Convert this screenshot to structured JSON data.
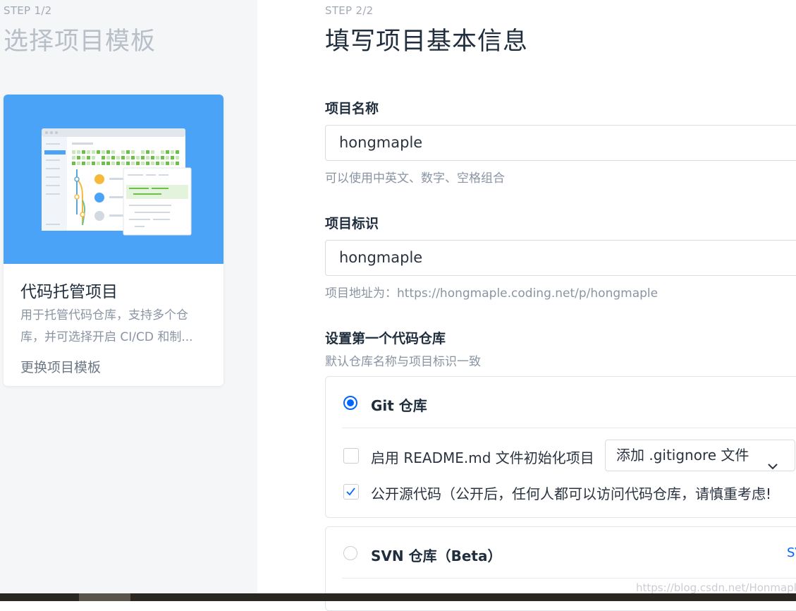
{
  "left_panel": {
    "step": "STEP 1/2",
    "title": "选择项目模板",
    "card": {
      "title": "代码托管项目",
      "description": "用于托管代码仓库，支持多个仓库，并可选择开启 CI/CD 和制...",
      "change_link": "更换项目模板"
    }
  },
  "right_panel": {
    "step": "STEP 2/2",
    "title": "填写项目基本信息",
    "project_name": {
      "label": "项目名称",
      "value": "hongmaple",
      "hint": "可以使用中英文、数字、空格组合"
    },
    "project_id": {
      "label": "项目标识",
      "value": "hongmaple",
      "hint": "项目地址为：https://hongmaple.coding.net/p/hongmaple"
    },
    "repo_section": {
      "label": "设置第一个代码仓库",
      "hint": "默认仓库名称与项目标识一致",
      "git": {
        "name": "Git 仓库",
        "readme_label": "启用 README.md 文件初始化项目",
        "gitignore_select": "添加 .gitignore 文件",
        "public_label": "公开源代码（公开后，任何人都可以访问代码仓库，请慎重考虑!"
      },
      "svn": {
        "name": "SVN 仓库（Beta）",
        "link": "SV"
      }
    }
  },
  "watermark": "https://blog.csdn.net/Honmaple",
  "colors": {
    "accent": "#0066ff",
    "hero": "#4aa3f7"
  }
}
